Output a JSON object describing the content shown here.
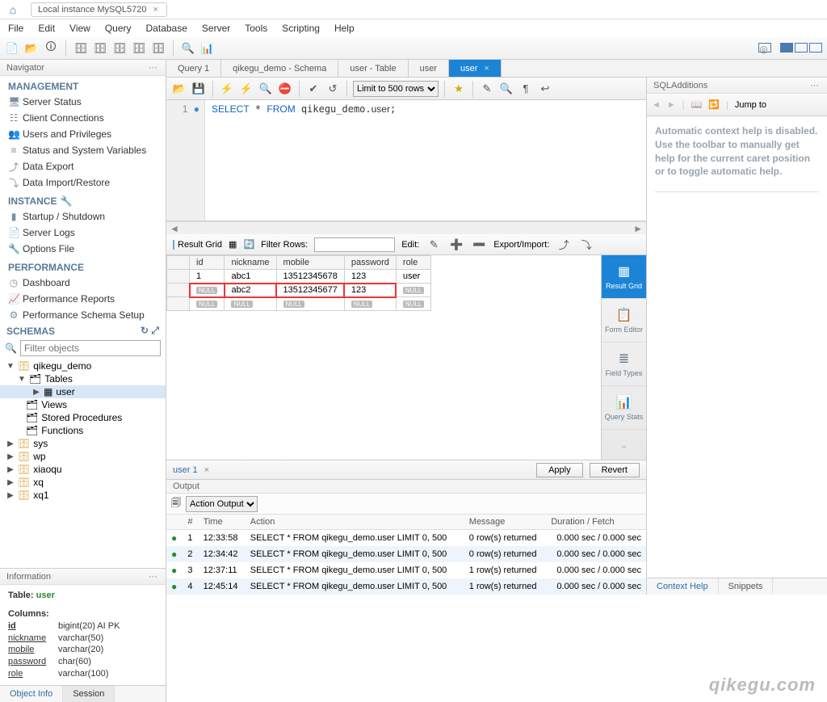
{
  "title_tab": "Local instance MySQL5720",
  "menu": [
    "File",
    "Edit",
    "View",
    "Query",
    "Database",
    "Server",
    "Tools",
    "Scripting",
    "Help"
  ],
  "navigator": {
    "title": "Navigator",
    "management_title": "MANAGEMENT",
    "management": [
      "Server Status",
      "Client Connections",
      "Users and Privileges",
      "Status and System Variables",
      "Data Export",
      "Data Import/Restore"
    ],
    "instance_title": "INSTANCE",
    "instance": [
      "Startup / Shutdown",
      "Server Logs",
      "Options File"
    ],
    "performance_title": "PERFORMANCE",
    "performance": [
      "Dashboard",
      "Performance Reports",
      "Performance Schema Setup"
    ],
    "schemas_title": "SCHEMAS",
    "filter_placeholder": "Filter objects",
    "tree": {
      "db": "qikegu_demo",
      "tables_label": "Tables",
      "table": "user",
      "views_label": "Views",
      "sp_label": "Stored Procedures",
      "fn_label": "Functions",
      "others": [
        "sys",
        "wp",
        "xiaoqu",
        "xq",
        "xq1"
      ]
    }
  },
  "info": {
    "title": "Information",
    "table_label": "Table:",
    "table_name": "user",
    "columns_label": "Columns:",
    "cols": [
      {
        "n": "id",
        "t": "bigint(20) AI PK"
      },
      {
        "n": "nickname",
        "t": "varchar(50)"
      },
      {
        "n": "mobile",
        "t": "varchar(20)"
      },
      {
        "n": "password",
        "t": "char(60)"
      },
      {
        "n": "role",
        "t": "varchar(100)"
      }
    ],
    "tabs": [
      "Object Info",
      "Session"
    ]
  },
  "editor": {
    "tabs": [
      "Query 1",
      "qikegu_demo - Schema",
      "user - Table",
      "user",
      "user"
    ],
    "active_index": 4,
    "limit_label": "Limit to 500 rows",
    "sql_line_no": "1",
    "sql_html": "SELECT * FROM qikegu_demo.user;"
  },
  "result": {
    "bar_label": "Result Grid",
    "filter_label": "Filter Rows:",
    "edit_label": "Edit:",
    "export_label": "Export/Import:",
    "headers": [
      "id",
      "nickname",
      "mobile",
      "password",
      "role"
    ],
    "rows": [
      {
        "id": "1",
        "nickname": "abc1",
        "mobile": "13512345678",
        "password": "123",
        "role": "user",
        "hl": false
      },
      {
        "id": "NULL",
        "nickname": "abc2",
        "mobile": "13512345677",
        "password": "123",
        "role": "NULL",
        "hl": true
      },
      {
        "id": "NULL",
        "nickname": "NULL",
        "mobile": "NULL",
        "password": "NULL",
        "role": "NULL",
        "hl": false
      }
    ],
    "side_tabs": [
      "Result Grid",
      "Form Editor",
      "Field Types",
      "Query Stats"
    ]
  },
  "bottom": {
    "doc_label": "user 1",
    "apply": "Apply",
    "revert": "Revert"
  },
  "output": {
    "title": "Output",
    "dropdown": "Action Output",
    "headers": [
      "",
      "#",
      "Time",
      "Action",
      "Message",
      "Duration / Fetch"
    ],
    "rows": [
      {
        "n": "1",
        "t": "12:33:58",
        "a": "SELECT * FROM qikegu_demo.user LIMIT 0, 500",
        "m": "0 row(s) returned",
        "d": "0.000 sec / 0.000 sec"
      },
      {
        "n": "2",
        "t": "12:34:42",
        "a": "SELECT * FROM qikegu_demo.user LIMIT 0, 500",
        "m": "0 row(s) returned",
        "d": "0.000 sec / 0.000 sec"
      },
      {
        "n": "3",
        "t": "12:37:11",
        "a": "SELECT * FROM qikegu_demo.user LIMIT 0, 500",
        "m": "1 row(s) returned",
        "d": "0.000 sec / 0.000 sec"
      },
      {
        "n": "4",
        "t": "12:45:14",
        "a": "SELECT * FROM qikegu_demo.user LIMIT 0, 500",
        "m": "1 row(s) returned",
        "d": "0.000 sec / 0.000 sec"
      }
    ]
  },
  "additions": {
    "title": "SQLAdditions",
    "jump_label": "Jump to",
    "help_text": "Automatic context help is disabled. Use the toolbar to manually get help for the current caret position or to toggle automatic help.",
    "tabs": [
      "Context Help",
      "Snippets"
    ]
  },
  "watermark": "qikegu.com"
}
